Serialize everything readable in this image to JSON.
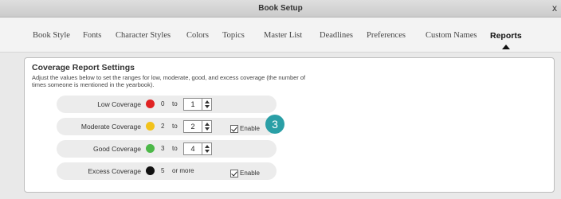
{
  "window": {
    "title": "Book Setup",
    "close_glyph": "x"
  },
  "tabs": [
    {
      "label": "Book Style"
    },
    {
      "label": "Fonts"
    },
    {
      "label": "Character Styles"
    },
    {
      "label": "Colors"
    },
    {
      "label": "Topics"
    },
    {
      "label": "Master List"
    },
    {
      "label": "Deadlines"
    },
    {
      "label": "Preferences"
    },
    {
      "label": "Custom Names"
    },
    {
      "label": "Reports",
      "active": true
    }
  ],
  "coverage": {
    "title": "Coverage Report Settings",
    "description": "Adjust the values below to set the ranges for low, moderate, good, and excess coverage (the number of times someone is mentioned in the yearbook).",
    "to_text": "to",
    "or_more_text": "or more",
    "enable_label": "Enable",
    "rows": [
      {
        "label": "Low Coverage",
        "color": "#e02222",
        "min": "0",
        "max": "1",
        "has_enable": false
      },
      {
        "label": "Moderate Coverage",
        "color": "#f2c21a",
        "min": "2",
        "max": "2",
        "has_enable": true
      },
      {
        "label": "Good Coverage",
        "color": "#4cb848",
        "min": "3",
        "max": "4",
        "has_enable": false
      },
      {
        "label": "Excess Coverage",
        "color": "#111111",
        "min": "5",
        "has_enable": true
      }
    ]
  },
  "callout": {
    "number": "3",
    "color": "#2a9fa6"
  }
}
